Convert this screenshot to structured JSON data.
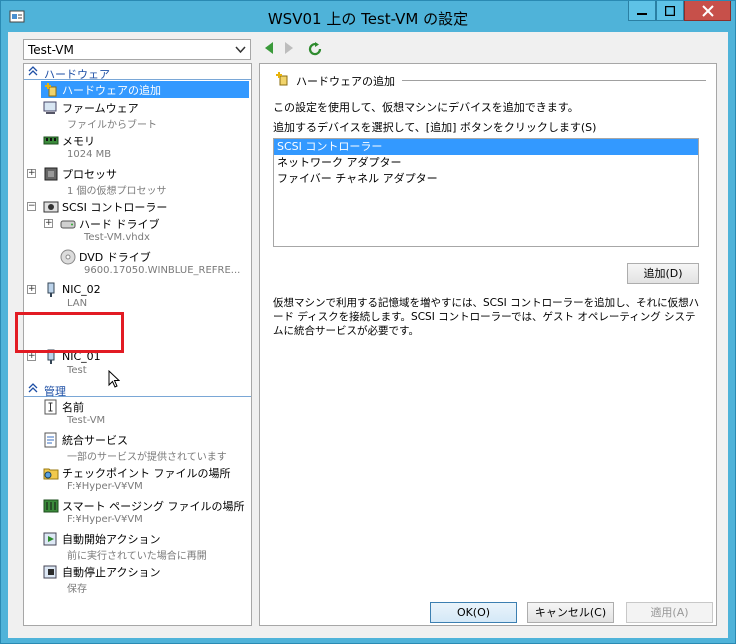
{
  "window": {
    "title": "WSV01 上の Test-VM の設定"
  },
  "vm_selector": {
    "value": "Test-VM"
  },
  "tree": {
    "hardware_header": "ハードウェア",
    "management_header": "管理",
    "items": [
      {
        "label": "ハードウェアの追加",
        "sub": ""
      },
      {
        "label": "ファームウェア",
        "sub": "ファイルからブート"
      },
      {
        "label": "メモリ",
        "sub": "1024 MB"
      },
      {
        "label": "プロセッサ",
        "sub": "1 個の仮想プロセッサ"
      },
      {
        "label": "SCSI コントローラー",
        "sub": ""
      },
      {
        "label": "ハード ドライブ",
        "sub": "Test-VM.vhdx"
      },
      {
        "label": "DVD ドライブ",
        "sub": "9600.17050.WINBLUE_REFRE..."
      },
      {
        "label": "NIC_02",
        "sub": "LAN"
      },
      {
        "label": "NIC_01",
        "sub": "Test"
      }
    ],
    "mgmt_items": [
      {
        "label": "名前",
        "sub": "Test-VM"
      },
      {
        "label": "統合サービス",
        "sub": "一部のサービスが提供されています"
      },
      {
        "label": "チェックポイント ファイルの場所",
        "sub": "F:¥Hyper-V¥VM"
      },
      {
        "label": "スマート ページング ファイルの場所",
        "sub": "F:¥Hyper-V¥VM"
      },
      {
        "label": "自動開始アクション",
        "sub": "前に実行されていた場合に再開"
      },
      {
        "label": "自動停止アクション",
        "sub": "保存"
      }
    ]
  },
  "panel": {
    "title": "ハードウェアの追加",
    "intro": "この設定を使用して、仮想マシンにデバイスを追加できます。",
    "instruction": "追加するデバイスを選択して、[追加] ボタンをクリックします(S)",
    "devices": [
      "SCSI コントローラー",
      "ネットワーク アダプター",
      "ファイバー チャネル アダプター"
    ],
    "add_button": "追加(D)",
    "description": "仮想マシンで利用する記憶域を増やすには、SCSI コントローラーを追加し、それに仮想ハード ディスクを接続します。SCSI コントローラーでは、ゲスト オペレーティング システムに統合サービスが必要です。"
  },
  "footer": {
    "ok": "OK(O)",
    "cancel": "キャンセル(C)",
    "apply": "適用(A)"
  },
  "colors": {
    "titlebar": "#4fb3d9",
    "selection": "#3399ff",
    "highlight_box": "#e21b23",
    "section_text": "#1e4fa5"
  }
}
